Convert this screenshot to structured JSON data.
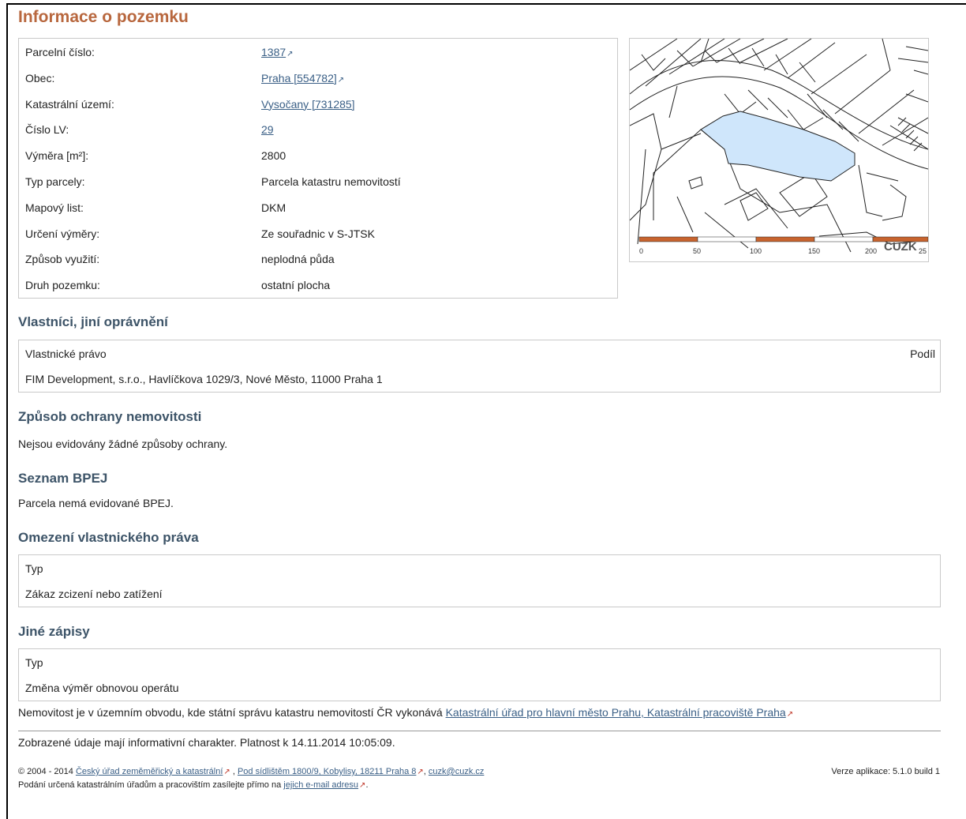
{
  "page_title": "Informace o pozemku",
  "parcel_info": [
    {
      "label": "Parcelní číslo:",
      "value": "1387",
      "link": true,
      "external": true
    },
    {
      "label": "Obec:",
      "value": "Praha [554782]",
      "link": true,
      "external": true
    },
    {
      "label": "Katastrální území:",
      "value": "Vysočany [731285]",
      "link": true,
      "external": false
    },
    {
      "label": "Číslo LV:",
      "value": "29",
      "link": true,
      "external": false
    },
    {
      "label": "Výměra [m²]:",
      "value": "2800",
      "link": false
    },
    {
      "label": "Typ parcely:",
      "value": "Parcela katastru nemovitostí",
      "link": false
    },
    {
      "label": "Mapový list:",
      "value": "DKM",
      "link": false
    },
    {
      "label": "Určení výměry:",
      "value": "Ze souřadnic v S-JTSK",
      "link": false
    },
    {
      "label": "Způsob využití:",
      "value": "neplodná půda",
      "link": false
    },
    {
      "label": "Druh pozemku:",
      "value": "ostatní plocha",
      "link": false
    }
  ],
  "map": {
    "scale_labels": [
      "0",
      "50",
      "100",
      "150",
      "200",
      "25"
    ],
    "watermark": "CUZK",
    "parcel_color": "#cfe6fb",
    "scale_color": "#c8642e"
  },
  "owners": {
    "title": "Vlastníci, jiní oprávnění",
    "col_right_header": "Vlastnické právo",
    "col_share_header": "Podíl",
    "owner": "FIM Development, s.r.o., Havlíčkova 1029/3, Nové Město, 11000 Praha 1"
  },
  "protection": {
    "title": "Způsob ochrany nemovitosti",
    "text": "Nejsou evidovány žádné způsoby ochrany."
  },
  "bpej": {
    "title": "Seznam BPEJ",
    "text": "Parcela nemá evidované BPEJ."
  },
  "restrictions": {
    "title": "Omezení vlastnického práva",
    "header": "Typ",
    "item": "Zákaz zcizení nebo zatížení"
  },
  "other": {
    "title": "Jiné zápisy",
    "header": "Typ",
    "item": "Změna výměr obnovou operátu"
  },
  "office": {
    "text": "Nemovitost je v územním obvodu, kde státní správu katastru nemovitostí ČR vykonává ",
    "link": "Katastrální úřad pro hlavní město Prahu, Katastrální pracoviště Praha"
  },
  "validity": "Zobrazené údaje mají informativní charakter. Platnost k 14.11.2014 10:05:09.",
  "footer": {
    "copyright": "© 2004 - 2014 ",
    "org_link": "Český úřad zeměměřický a katastrální",
    "sep1": " , ",
    "address_link": "Pod sídlištěm 1800/9, Kobylisy, 18211 Praha 8",
    "sep2": ", ",
    "email_link": "cuzk@cuzk.cz",
    "submission_text": "Podání určená katastrálním úřadům a pracovištím zasílejte přímo na ",
    "submission_link": "jejich e-mail adresu",
    "submission_end": ".",
    "version": "Verze aplikace: 5.1.0 build 1"
  }
}
